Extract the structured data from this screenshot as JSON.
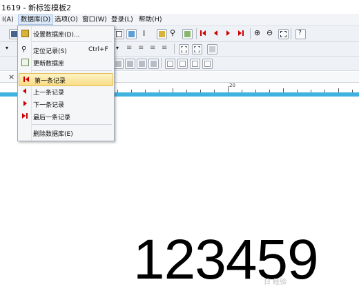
{
  "window": {
    "title": "1619 - 新标签模板2"
  },
  "menubar": {
    "items": [
      "I(A)",
      "数据库(D)",
      "选项(O)",
      "窗口(W)",
      "登录(L)",
      "帮助(H)"
    ],
    "active_index": 1
  },
  "dropdown": {
    "items": [
      {
        "label": "设置数据库(D)...",
        "shortcut": "",
        "icon": "database-settings-icon"
      },
      {
        "label": "定位记录(S)",
        "shortcut": "Ctrl+F",
        "icon": "binoculars-icon"
      },
      {
        "label": "更新数据库",
        "shortcut": "",
        "icon": "refresh-database-icon"
      },
      {
        "label": "第一条记录",
        "shortcut": "",
        "icon": "first-record-icon",
        "highlighted": true
      },
      {
        "label": "上一条记录",
        "shortcut": "",
        "icon": "previous-record-icon"
      },
      {
        "label": "下一条记录",
        "shortcut": "",
        "icon": "next-record-icon"
      },
      {
        "label": "最后一条记录",
        "shortcut": "",
        "icon": "last-record-icon"
      },
      {
        "label": "删除数据库(E)",
        "shortcut": "",
        "icon": ""
      }
    ]
  },
  "tabstrip": {
    "close_glyph": "×"
  },
  "ruler": {
    "label_20": "20"
  },
  "canvas": {
    "barcode_text": "123459"
  },
  "watermark": {
    "text": "日 经验"
  },
  "colors": {
    "accent_blue": "#3fb2e0",
    "highlight": "#f9dc86",
    "nav_red": "#cc0000"
  }
}
